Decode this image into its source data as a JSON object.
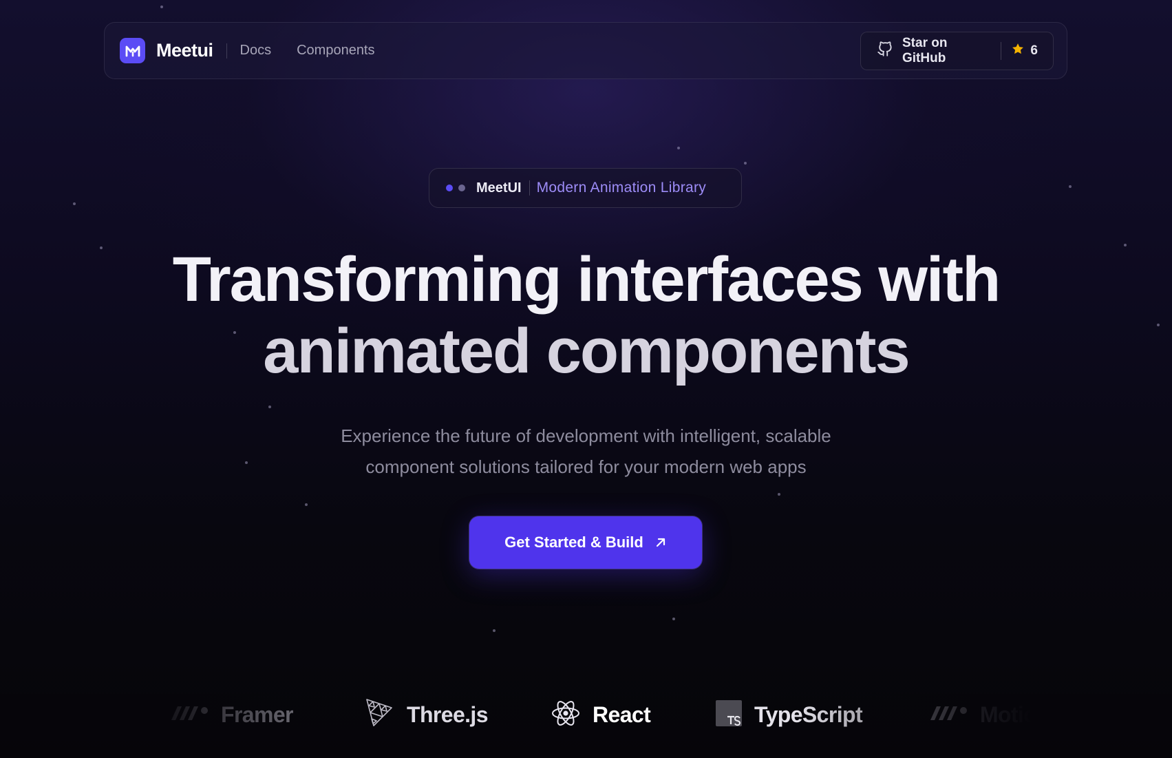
{
  "nav": {
    "brand": "Meetui",
    "links": [
      "Docs",
      "Components"
    ],
    "github": {
      "label": "Star on GitHub",
      "count": "6"
    }
  },
  "badge": {
    "brand": "MeetUI",
    "tagline": "Modern Animation Library"
  },
  "hero": {
    "title_line1": "Transforming interfaces with",
    "title_line2": "animated components",
    "subtitle_line1": "Experience the future of development with intelligent, scalable",
    "subtitle_line2": "component solutions tailored for your modern web apps",
    "cta_label": "Get Started & Build"
  },
  "tech_logos": [
    "Framer",
    "Three.js",
    "React",
    "TypeScript",
    "Motion"
  ],
  "colors": {
    "accent": "#4f34ec",
    "logo_bg": "#5b4cf5",
    "badge_text": "#9d8cf7",
    "star": "#f5b301"
  }
}
